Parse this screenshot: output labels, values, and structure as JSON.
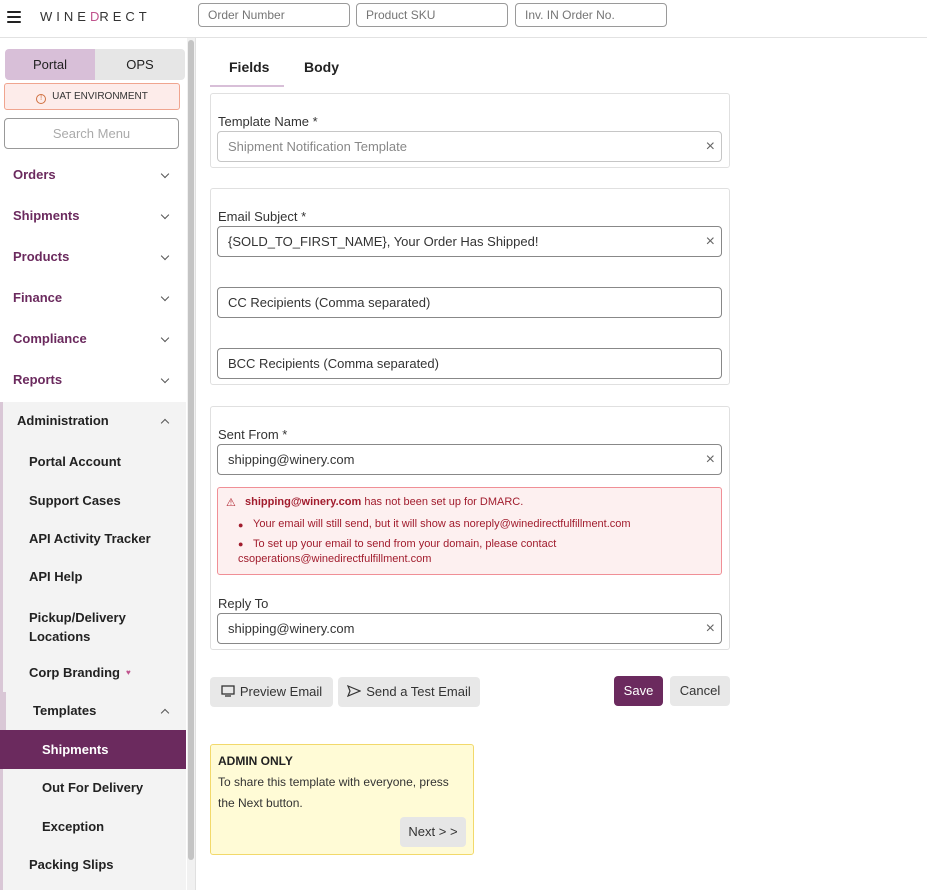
{
  "header": {
    "brand_prefix": "WINE",
    "brand_mark": "D",
    "brand_suffix": "RECT",
    "search_order_placeholder": "Order Number",
    "search_sku_placeholder": "Product SKU",
    "search_inv_placeholder": "Inv. IN Order No."
  },
  "sidebar": {
    "toggle": {
      "portal": "Portal",
      "ops": "OPS"
    },
    "env_badge": "UAT ENVIRONMENT",
    "search_placeholder": "Search Menu",
    "items": [
      {
        "label": "Orders"
      },
      {
        "label": "Shipments"
      },
      {
        "label": "Products"
      },
      {
        "label": "Finance"
      },
      {
        "label": "Compliance"
      },
      {
        "label": "Reports"
      },
      {
        "label": "Administration"
      }
    ],
    "admin_children": [
      {
        "label": "Portal Account"
      },
      {
        "label": "Support Cases"
      },
      {
        "label": "API Activity Tracker"
      },
      {
        "label": "API Help"
      },
      {
        "label": "Pickup/Delivery",
        "label2": "Locations"
      },
      {
        "label": "Corp Branding"
      },
      {
        "label": "Templates"
      }
    ],
    "template_children": [
      {
        "label": "Shipments"
      },
      {
        "label": "Out For Delivery"
      },
      {
        "label": "Exception"
      }
    ],
    "packing_slips": "Packing Slips"
  },
  "main": {
    "tabs": [
      {
        "label": "Fields"
      },
      {
        "label": "Body"
      }
    ],
    "template_name_label": "Template Name *",
    "template_name_value": "Shipment Notification Template",
    "email_subject_label": "Email Subject *",
    "email_subject_value": "{SOLD_TO_FIRST_NAME}, Your Order Has Shipped!",
    "cc_placeholder": "CC Recipients (Comma separated)",
    "bcc_placeholder": "BCC Recipients (Comma separated)",
    "sent_from_label": "Sent From *",
    "sent_from_value": "shipping@winery.com",
    "warning": {
      "email": "shipping@winery.com",
      "message": " has not been set up for DMARC.",
      "bullet1": "Your email will still send, but it will show as noreply@winedirectfulfillment.com",
      "bullet2a": "To set up your email to send from your domain, please contact",
      "bullet2b": "csoperations@winedirectfulfillment.com"
    },
    "reply_to_label": "Reply To",
    "reply_to_value": "shipping@winery.com",
    "buttons": {
      "preview": "Preview Email",
      "test": "Send a Test Email",
      "save": "Save",
      "cancel": "Cancel"
    },
    "admin_box": {
      "title": "ADMIN ONLY",
      "desc": "To share this template with everyone, press the Next button.",
      "next": "Next > >"
    }
  },
  "colors": {
    "brand": "#6b2a5e",
    "accent": "#d8bfd8",
    "warning_text": "#a11c2d"
  }
}
